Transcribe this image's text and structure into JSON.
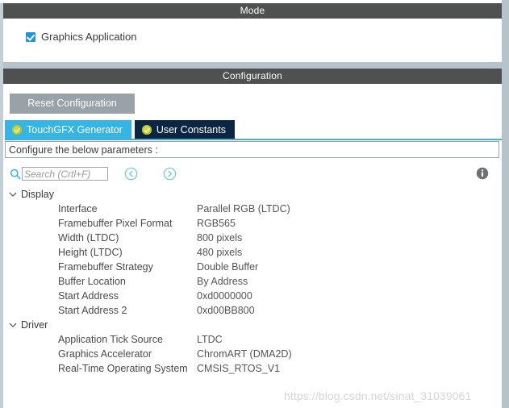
{
  "mode": {
    "header": "Mode",
    "checkbox": {
      "label": "Graphics Application",
      "checked": true,
      "color": "#2196d6"
    }
  },
  "configuration": {
    "header": "Configuration",
    "reset_button": "Reset Configuration",
    "tabs": [
      {
        "label": "TouchGFX Generator",
        "icon": "check-circle-icon",
        "active": true,
        "color": "#35b5e5"
      },
      {
        "label": "User Constants",
        "icon": "check-circle-icon",
        "active": false,
        "color": "#0b2545"
      }
    ],
    "instruction": "Configure the below parameters :",
    "toolbar": {
      "search_placeholder": "Search (Crtl+F)",
      "search_value": "",
      "search_icon": "search-icon",
      "prev_icon": "chevron-left-circle-icon",
      "next_icon": "chevron-right-circle-icon",
      "info_icon": "info-icon"
    },
    "groups": [
      {
        "label": "Display",
        "expanded": true,
        "parameters": [
          {
            "name": "Interface",
            "value": "Parallel RGB (LTDC)"
          },
          {
            "name": "Framebuffer Pixel Format",
            "value": "RGB565"
          },
          {
            "name": "Width (LTDC)",
            "value": "800 pixels"
          },
          {
            "name": "Height (LTDC)",
            "value": "480 pixels"
          },
          {
            "name": "Framebuffer Strategy",
            "value": "Double Buffer"
          },
          {
            "name": "Buffer Location",
            "value": "By Address"
          },
          {
            "name": "Start Address",
            "value": "0xd0000000"
          },
          {
            "name": "Start Address 2",
            "value": "0xd00BB800"
          }
        ]
      },
      {
        "label": "Driver",
        "expanded": true,
        "parameters": [
          {
            "name": "Application Tick Source",
            "value": "LTDC"
          },
          {
            "name": "Graphics Accelerator",
            "value": "ChromART (DMA2D)"
          },
          {
            "name": "Real-Time Operating System",
            "value": "CMSIS_RTOS_V1"
          }
        ]
      }
    ]
  },
  "watermark": "https://blog.csdn.net/sinat_31039061"
}
